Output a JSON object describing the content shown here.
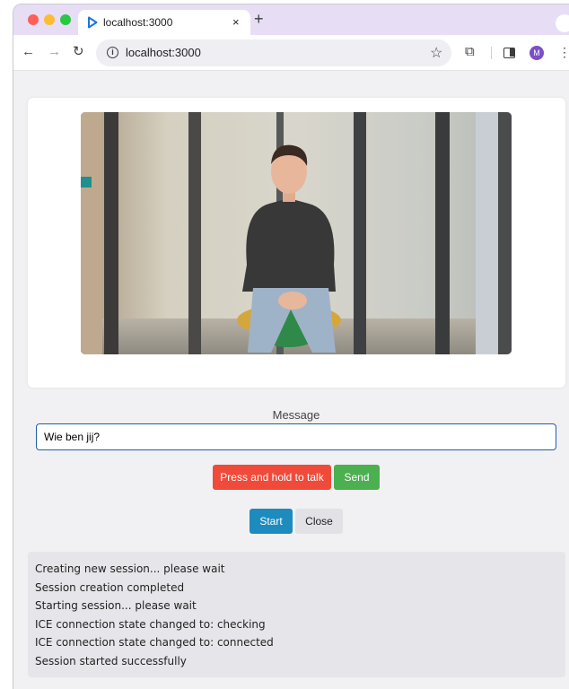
{
  "browser": {
    "tab_title": "localhost:3000",
    "tab_close": "×",
    "new_tab": "+",
    "url": "localhost:3000",
    "avatar_initial": "M"
  },
  "icons": {
    "back": "←",
    "forward": "→",
    "reload": "↻",
    "info": "i",
    "star": "☆",
    "extensions": "⧉",
    "menu": "⋮",
    "tab_menu": "⌄"
  },
  "message": {
    "label": "Message",
    "input_value": "Wie ben jij?"
  },
  "buttons": {
    "talk": "Press and hold to talk",
    "send": "Send",
    "start": "Start",
    "close": "Close"
  },
  "log": [
    "Creating new session... please wait",
    "Session creation completed",
    "Starting session... please wait",
    "ICE connection state changed to: checking",
    "ICE connection state changed to: connected",
    "Session started successfully"
  ],
  "colors": {
    "tabstrip": "#e7def6",
    "talk_button": "#f04a3a",
    "send_button": "#4caf50",
    "start_button": "#1d8bbd",
    "close_button": "#e2e2e6",
    "input_border": "#1f5fa8"
  }
}
